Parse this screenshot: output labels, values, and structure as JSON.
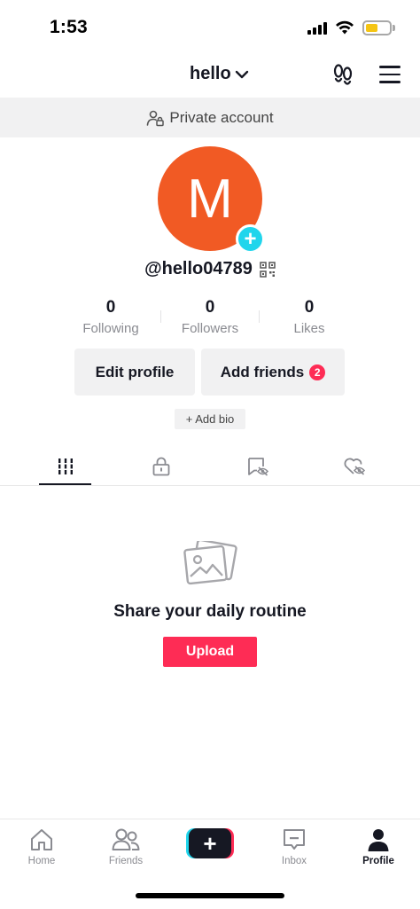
{
  "status_bar": {
    "time": "1:53",
    "battery_color": "#f5c514"
  },
  "header": {
    "account_name": "hello",
    "dropdown_icon": "chevron-down-icon",
    "footprints_icon": "footprints-icon",
    "menu_icon": "hamburger-menu-icon"
  },
  "private_banner": {
    "icon": "person-lock-icon",
    "text": "Private account"
  },
  "profile": {
    "avatar_letter": "M",
    "avatar_color": "#f15a24",
    "add_icon": "plus-icon",
    "add_symbol": "+",
    "username": "@hello04789",
    "qr_icon": "qr-code-icon",
    "stats": [
      {
        "value": "0",
        "label": "Following"
      },
      {
        "value": "0",
        "label": "Followers"
      },
      {
        "value": "0",
        "label": "Likes"
      }
    ],
    "edit_profile_label": "Edit profile",
    "add_friends_label": "Add friends",
    "add_friends_badge": "2",
    "add_bio_label": "+ Add bio"
  },
  "tabs": [
    {
      "name": "videos",
      "icon": "grid-bars-icon",
      "active": true
    },
    {
      "name": "private",
      "icon": "lock-icon",
      "active": false
    },
    {
      "name": "reposts",
      "icon": "eye-slash-bookmark-icon",
      "active": false
    },
    {
      "name": "liked",
      "icon": "heart-slash-icon",
      "active": false
    }
  ],
  "empty_state": {
    "icon": "photos-icon",
    "title": "Share your daily routine",
    "upload_label": "Upload"
  },
  "bottom_nav": {
    "items": [
      {
        "label": "Home",
        "icon": "home-icon",
        "active": false
      },
      {
        "label": "Friends",
        "icon": "friends-icon",
        "active": false
      },
      {
        "label": "",
        "icon": "create-plus-icon",
        "active": false
      },
      {
        "label": "Inbox",
        "icon": "inbox-icon",
        "active": false
      },
      {
        "label": "Profile",
        "icon": "profile-icon",
        "active": true
      }
    ],
    "create_symbol": "+"
  },
  "colors": {
    "accent_red": "#fe2c55",
    "accent_cyan": "#20d5ec",
    "text_primary": "#161823",
    "text_secondary": "#8a8b91"
  }
}
